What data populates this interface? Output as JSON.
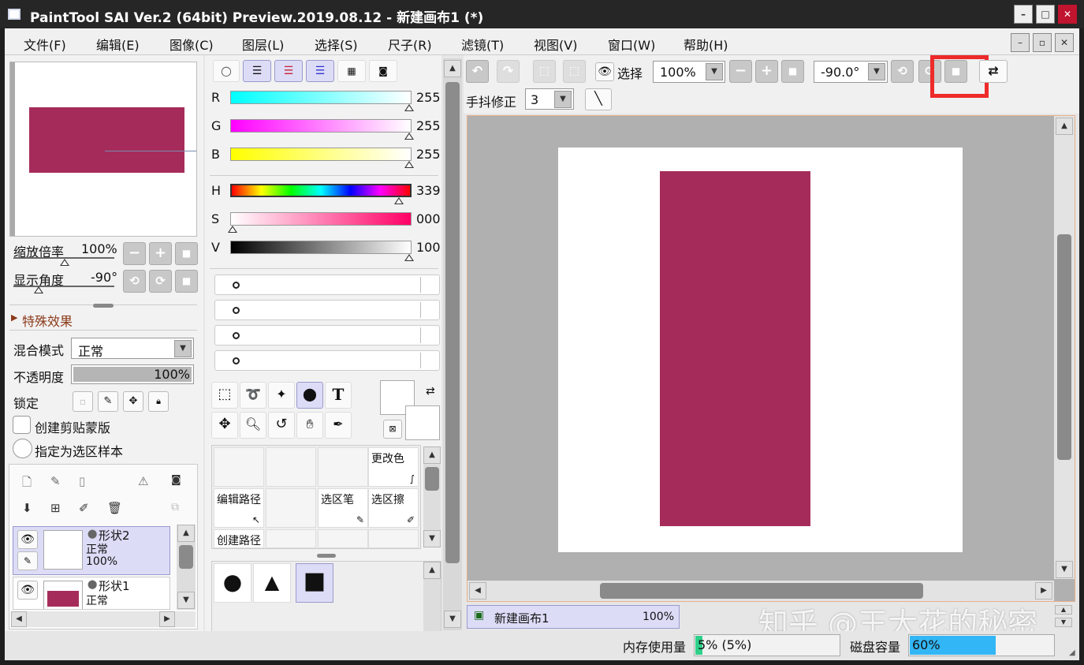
{
  "window": {
    "title": "PaintTool SAI Ver.2 (64bit) Preview.2019.08.12 - 新建画布1 (*)",
    "minimize": "–",
    "maximize": "□",
    "close": "✕"
  },
  "menu": [
    "文件(F)",
    "编辑(E)",
    "图像(C)",
    "图层(L)",
    "选择(S)",
    "尺子(R)",
    "滤镜(T)",
    "视图(V)",
    "窗口(W)",
    "帮助(H)"
  ],
  "mdi": {
    "minimize": "–",
    "restore": "▫",
    "close": "✕"
  },
  "navigator": {
    "zoom_label": "缩放倍率",
    "zoom_value": "100%",
    "angle_label": "显示角度",
    "angle_value": "-90°"
  },
  "effects": {
    "label": "特殊效果"
  },
  "layer_props": {
    "blend_label": "混合模式",
    "blend_value": "正常",
    "opacity_label": "不透明度",
    "opacity_value": "100%",
    "opacity_fraction": 1.0,
    "lock_label": "锁定",
    "clip_label": "创建剪贴蒙版",
    "selection_sample_label": "指定为选区样本"
  },
  "layers": [
    {
      "name": "形状2",
      "mode": "正常",
      "opacity": "100%",
      "selected": true
    },
    {
      "name": "形状1",
      "mode": "正常",
      "opacity": "",
      "selected": false
    }
  ],
  "color": {
    "rgb": [
      {
        "label": "R",
        "value": "255"
      },
      {
        "label": "G",
        "value": "255"
      },
      {
        "label": "B",
        "value": "255"
      }
    ],
    "hsv": [
      {
        "label": "H",
        "value": "339"
      },
      {
        "label": "S",
        "value": "000"
      },
      {
        "label": "V",
        "value": "100"
      }
    ],
    "accent_shape": "#a52c5a"
  },
  "tool_grid": {
    "change_color": "更改色",
    "edit_path": "编辑路径",
    "selection_pen": "选区笔",
    "selection_eraser": "选区擦",
    "create_path": "创建路径"
  },
  "toolbar": {
    "select_label": "选择",
    "zoom_value": "100%",
    "angle_value": "-90.0°",
    "stabilizer_label": "手抖修正",
    "stabilizer_value": "3"
  },
  "canvas": {
    "shape_color": "#a52c5a"
  },
  "tabs": [
    {
      "name": "新建画布1",
      "zoom": "100%"
    }
  ],
  "status": {
    "memory_label": "内存使用量",
    "memory_value": "5% (5%)",
    "memory_fraction": 0.05,
    "disk_label": "磁盘容量",
    "disk_value": "60%",
    "disk_fraction": 0.6
  },
  "watermark": "知乎 @王大花的秘密"
}
